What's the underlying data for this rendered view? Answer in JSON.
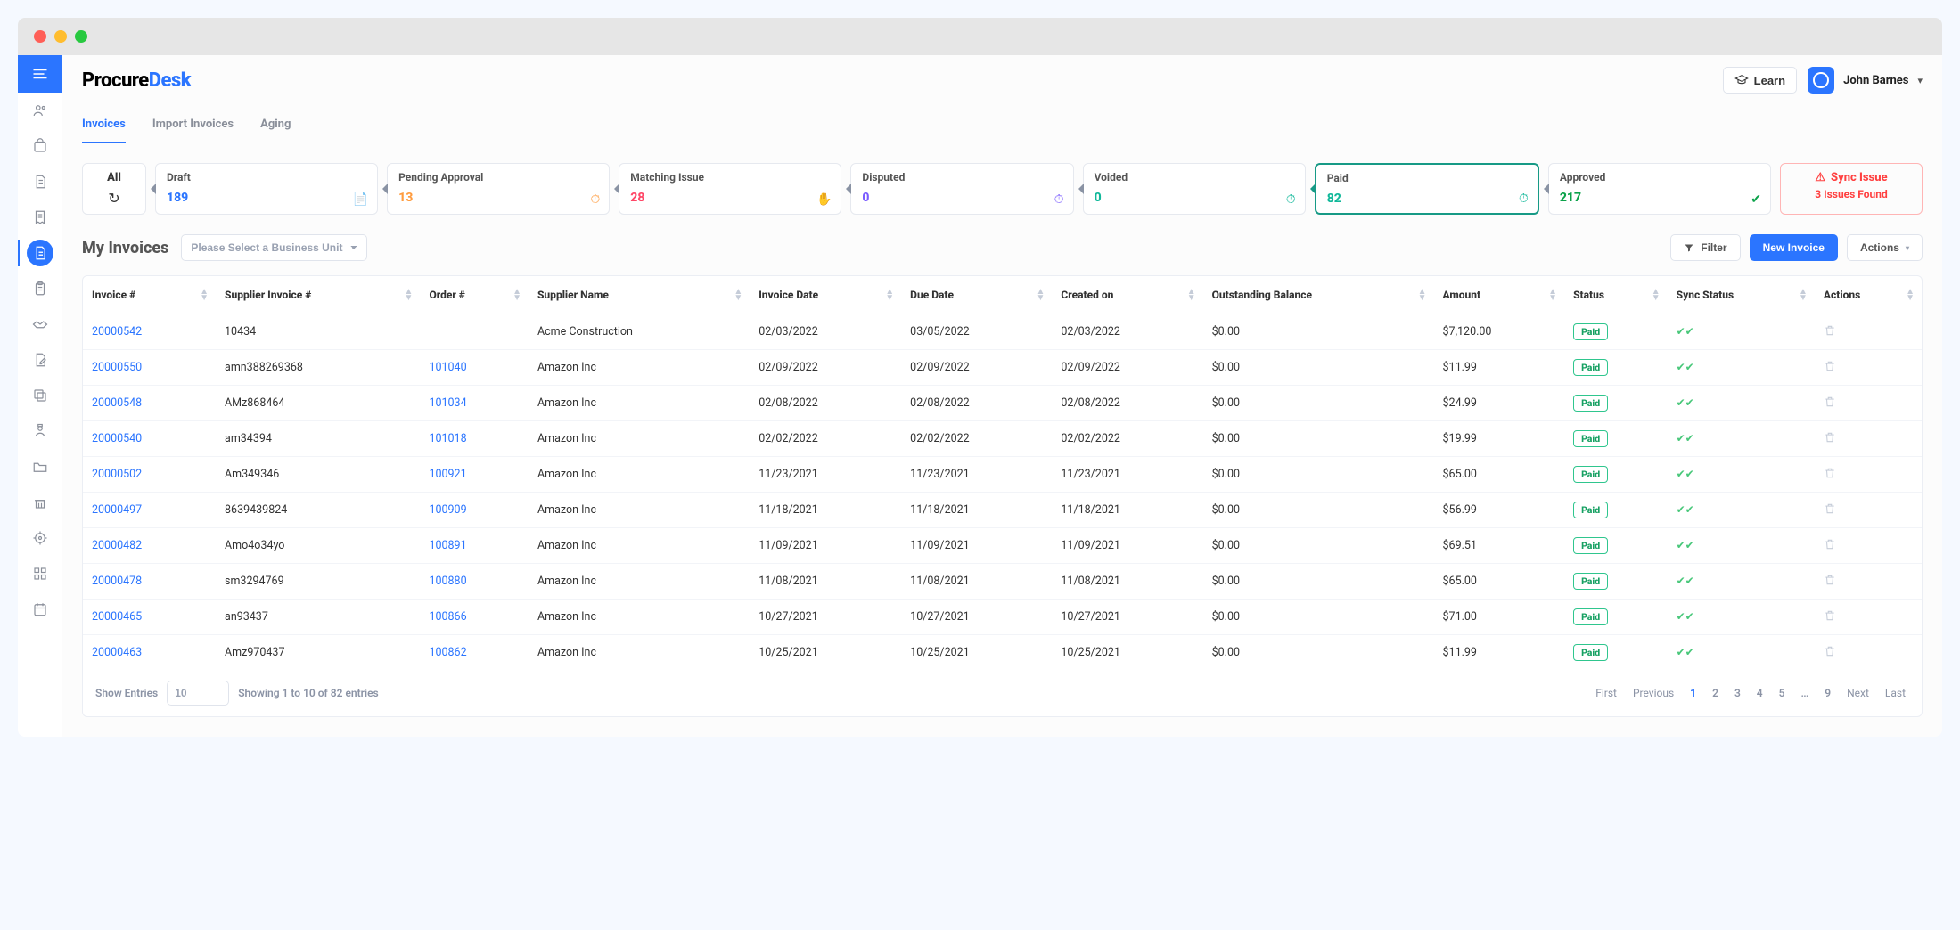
{
  "brand": {
    "part1": "Procure",
    "part2": "Desk"
  },
  "header": {
    "learn": "Learn",
    "user_name": "John Barnes"
  },
  "tabs": [
    {
      "label": "Invoices",
      "active": true
    },
    {
      "label": "Import Invoices",
      "active": false
    },
    {
      "label": "Aging",
      "active": false
    }
  ],
  "status_cards": {
    "all_label": "All",
    "items": [
      {
        "label": "Draft",
        "value": "189",
        "value_class": "c-blue",
        "icon": "📄",
        "icon_color": "c-blue",
        "active": false
      },
      {
        "label": "Pending Approval",
        "value": "13",
        "value_class": "c-orange",
        "icon": "⏱",
        "icon_color": "c-orange",
        "active": false
      },
      {
        "label": "Matching Issue",
        "value": "28",
        "value_class": "c-red",
        "icon": "✋",
        "icon_color": "c-red",
        "active": false
      },
      {
        "label": "Disputed",
        "value": "0",
        "value_class": "c-purple",
        "icon": "⏱",
        "icon_color": "c-purple",
        "active": false
      },
      {
        "label": "Voided",
        "value": "0",
        "value_class": "c-teal",
        "icon": "⏱",
        "icon_color": "c-teal",
        "active": false
      },
      {
        "label": "Paid",
        "value": "82",
        "value_class": "c-teal",
        "icon": "⏱",
        "icon_color": "c-teal",
        "active": true
      },
      {
        "label": "Approved",
        "value": "217",
        "value_class": "c-green",
        "icon": "✔",
        "icon_color": "c-green",
        "active": false
      }
    ]
  },
  "sync_issue": {
    "title": "Sync Issue",
    "subtitle": "3 Issues Found"
  },
  "page_title": "My Invoices",
  "bu_placeholder": "Please Select a Business Unit",
  "buttons": {
    "filter": "Filter",
    "new_invoice": "New Invoice",
    "actions": "Actions"
  },
  "columns": [
    "Invoice #",
    "Supplier Invoice #",
    "Order #",
    "Supplier Name",
    "Invoice Date",
    "Due Date",
    "Created on",
    "Outstanding Balance",
    "Amount",
    "Status",
    "Sync Status",
    "Actions"
  ],
  "rows": [
    {
      "invoice": "20000542",
      "supplier_inv": "10434",
      "order": "",
      "supplier": "Acme Construction",
      "inv_date": "02/03/2022",
      "due": "03/05/2022",
      "created": "02/03/2022",
      "outstanding": "$0.00",
      "amount": "$7,120.00",
      "status": "Paid"
    },
    {
      "invoice": "20000550",
      "supplier_inv": "amn388269368",
      "order": "101040",
      "supplier": "Amazon Inc",
      "inv_date": "02/09/2022",
      "due": "02/09/2022",
      "created": "02/09/2022",
      "outstanding": "$0.00",
      "amount": "$11.99",
      "status": "Paid"
    },
    {
      "invoice": "20000548",
      "supplier_inv": "AMz868464",
      "order": "101034",
      "supplier": "Amazon Inc",
      "inv_date": "02/08/2022",
      "due": "02/08/2022",
      "created": "02/08/2022",
      "outstanding": "$0.00",
      "amount": "$24.99",
      "status": "Paid"
    },
    {
      "invoice": "20000540",
      "supplier_inv": "am34394",
      "order": "101018",
      "supplier": "Amazon Inc",
      "inv_date": "02/02/2022",
      "due": "02/02/2022",
      "created": "02/02/2022",
      "outstanding": "$0.00",
      "amount": "$19.99",
      "status": "Paid"
    },
    {
      "invoice": "20000502",
      "supplier_inv": "Am349346",
      "order": "100921",
      "supplier": "Amazon Inc",
      "inv_date": "11/23/2021",
      "due": "11/23/2021",
      "created": "11/23/2021",
      "outstanding": "$0.00",
      "amount": "$65.00",
      "status": "Paid"
    },
    {
      "invoice": "20000497",
      "supplier_inv": "8639439824",
      "order": "100909",
      "supplier": "Amazon Inc",
      "inv_date": "11/18/2021",
      "due": "11/18/2021",
      "created": "11/18/2021",
      "outstanding": "$0.00",
      "amount": "$56.99",
      "status": "Paid"
    },
    {
      "invoice": "20000482",
      "supplier_inv": "Amo4o34yo",
      "order": "100891",
      "supplier": "Amazon Inc",
      "inv_date": "11/09/2021",
      "due": "11/09/2021",
      "created": "11/09/2021",
      "outstanding": "$0.00",
      "amount": "$69.51",
      "status": "Paid"
    },
    {
      "invoice": "20000478",
      "supplier_inv": "sm3294769",
      "order": "100880",
      "supplier": "Amazon Inc",
      "inv_date": "11/08/2021",
      "due": "11/08/2021",
      "created": "11/08/2021",
      "outstanding": "$0.00",
      "amount": "$65.00",
      "status": "Paid"
    },
    {
      "invoice": "20000465",
      "supplier_inv": "an93437",
      "order": "100866",
      "supplier": "Amazon Inc",
      "inv_date": "10/27/2021",
      "due": "10/27/2021",
      "created": "10/27/2021",
      "outstanding": "$0.00",
      "amount": "$71.00",
      "status": "Paid"
    },
    {
      "invoice": "20000463",
      "supplier_inv": "Amz970437",
      "order": "100862",
      "supplier": "Amazon Inc",
      "inv_date": "10/25/2021",
      "due": "10/25/2021",
      "created": "10/25/2021",
      "outstanding": "$0.00",
      "amount": "$11.99",
      "status": "Paid"
    }
  ],
  "footer": {
    "show_entries_label": "Show Entries",
    "entries_value": "10",
    "showing": "Showing 1 to 10 of 82 entries",
    "pages": {
      "first": "First",
      "prev": "Previous",
      "list": [
        "1",
        "2",
        "3",
        "4",
        "5",
        "…",
        "9"
      ],
      "active": "1",
      "next": "Next",
      "last": "Last"
    }
  }
}
